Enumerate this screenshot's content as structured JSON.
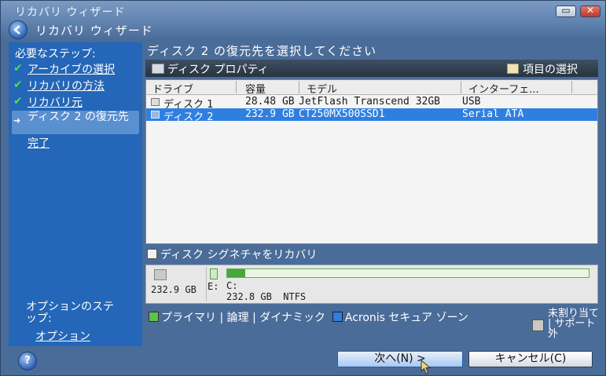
{
  "window": {
    "title": "リカバリ ウィザード",
    "restore_glyph": "▭",
    "close_glyph": "✕"
  },
  "header": {
    "title": "リカバリ ウィザード"
  },
  "steps": {
    "heading": "必要なステップ:",
    "items": [
      {
        "label": "アーカイブの選択",
        "state": "done"
      },
      {
        "label": "リカバリの方法",
        "state": "done"
      },
      {
        "label": "リカバリ元",
        "state": "done"
      },
      {
        "label": "ディスク 2 の復元先",
        "state": "current"
      },
      {
        "label": "完了",
        "state": "pending"
      }
    ],
    "options_heading": "オプションのステップ:",
    "options_link": "オプション"
  },
  "instruction": "ディスク 2 の復元先を選択してください",
  "properties_bar": {
    "title": "ディスク プロパティ",
    "select_items": "項目の選択"
  },
  "disk_table": {
    "columns": [
      "ドライブ",
      "容量",
      "モデル",
      "インターフェ..."
    ],
    "rows": [
      {
        "drive": "ディスク 1",
        "capacity": "28.48 GB",
        "model": "JetFlash Transcend 32GB",
        "interface": "USB",
        "selected": false
      },
      {
        "drive": "ディスク 2",
        "capacity": "232.9 GB",
        "model": "CT250MX500SSD1",
        "interface": "Serial ATA",
        "selected": true
      }
    ]
  },
  "signature_checkbox": {
    "label": "ディスク シグネチャをリカバリ",
    "checked": false
  },
  "partition": {
    "disk_size": "232.9 GB",
    "letter": "E:",
    "drive": "C:",
    "info": "232.8 GB  NTFS",
    "used_fraction": 0.05
  },
  "legend": {
    "primary": "プライマリ | 論理 | ダイナミック",
    "acronis": "Acronis セキュア ゾーン",
    "unallocated": "未割り当て | サポート外"
  },
  "buttons": {
    "next": "次へ(N) >",
    "cancel": "キャンセル(C)",
    "help": "?"
  },
  "colors": {
    "selection": "#2f7fe0",
    "primary_partition": "#45a83a",
    "panel": "#2466b7"
  }
}
